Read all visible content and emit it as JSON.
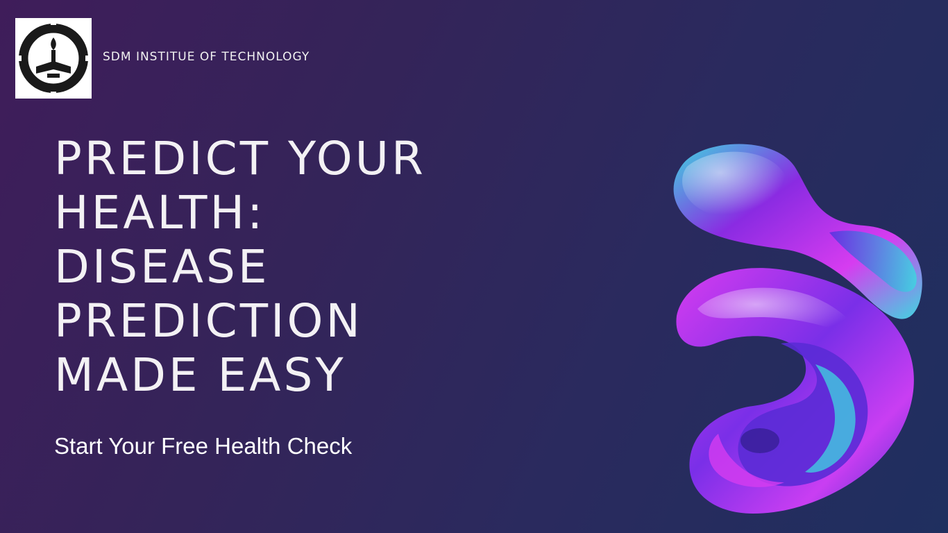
{
  "header": {
    "org_name": "SDM INSTITUE OF TECHNOLOGY",
    "logo_icon": "institute-seal-icon"
  },
  "hero": {
    "headline_lines": [
      "PREDICT YOUR",
      "HEALTH:",
      "DISEASE",
      "PREDICTION",
      "MADE EASY"
    ],
    "cta_label": "Start Your Free Health Check"
  },
  "decor": {
    "shape_icon": "abstract-3d-blob-icon"
  },
  "colors": {
    "bg_start": "#3f1d5a",
    "bg_end": "#1f2f5f",
    "text": "#f3f1f4",
    "shape_purple": "#8a2be2",
    "shape_magenta": "#d63cf0",
    "shape_cyan": "#3fd6e0"
  }
}
